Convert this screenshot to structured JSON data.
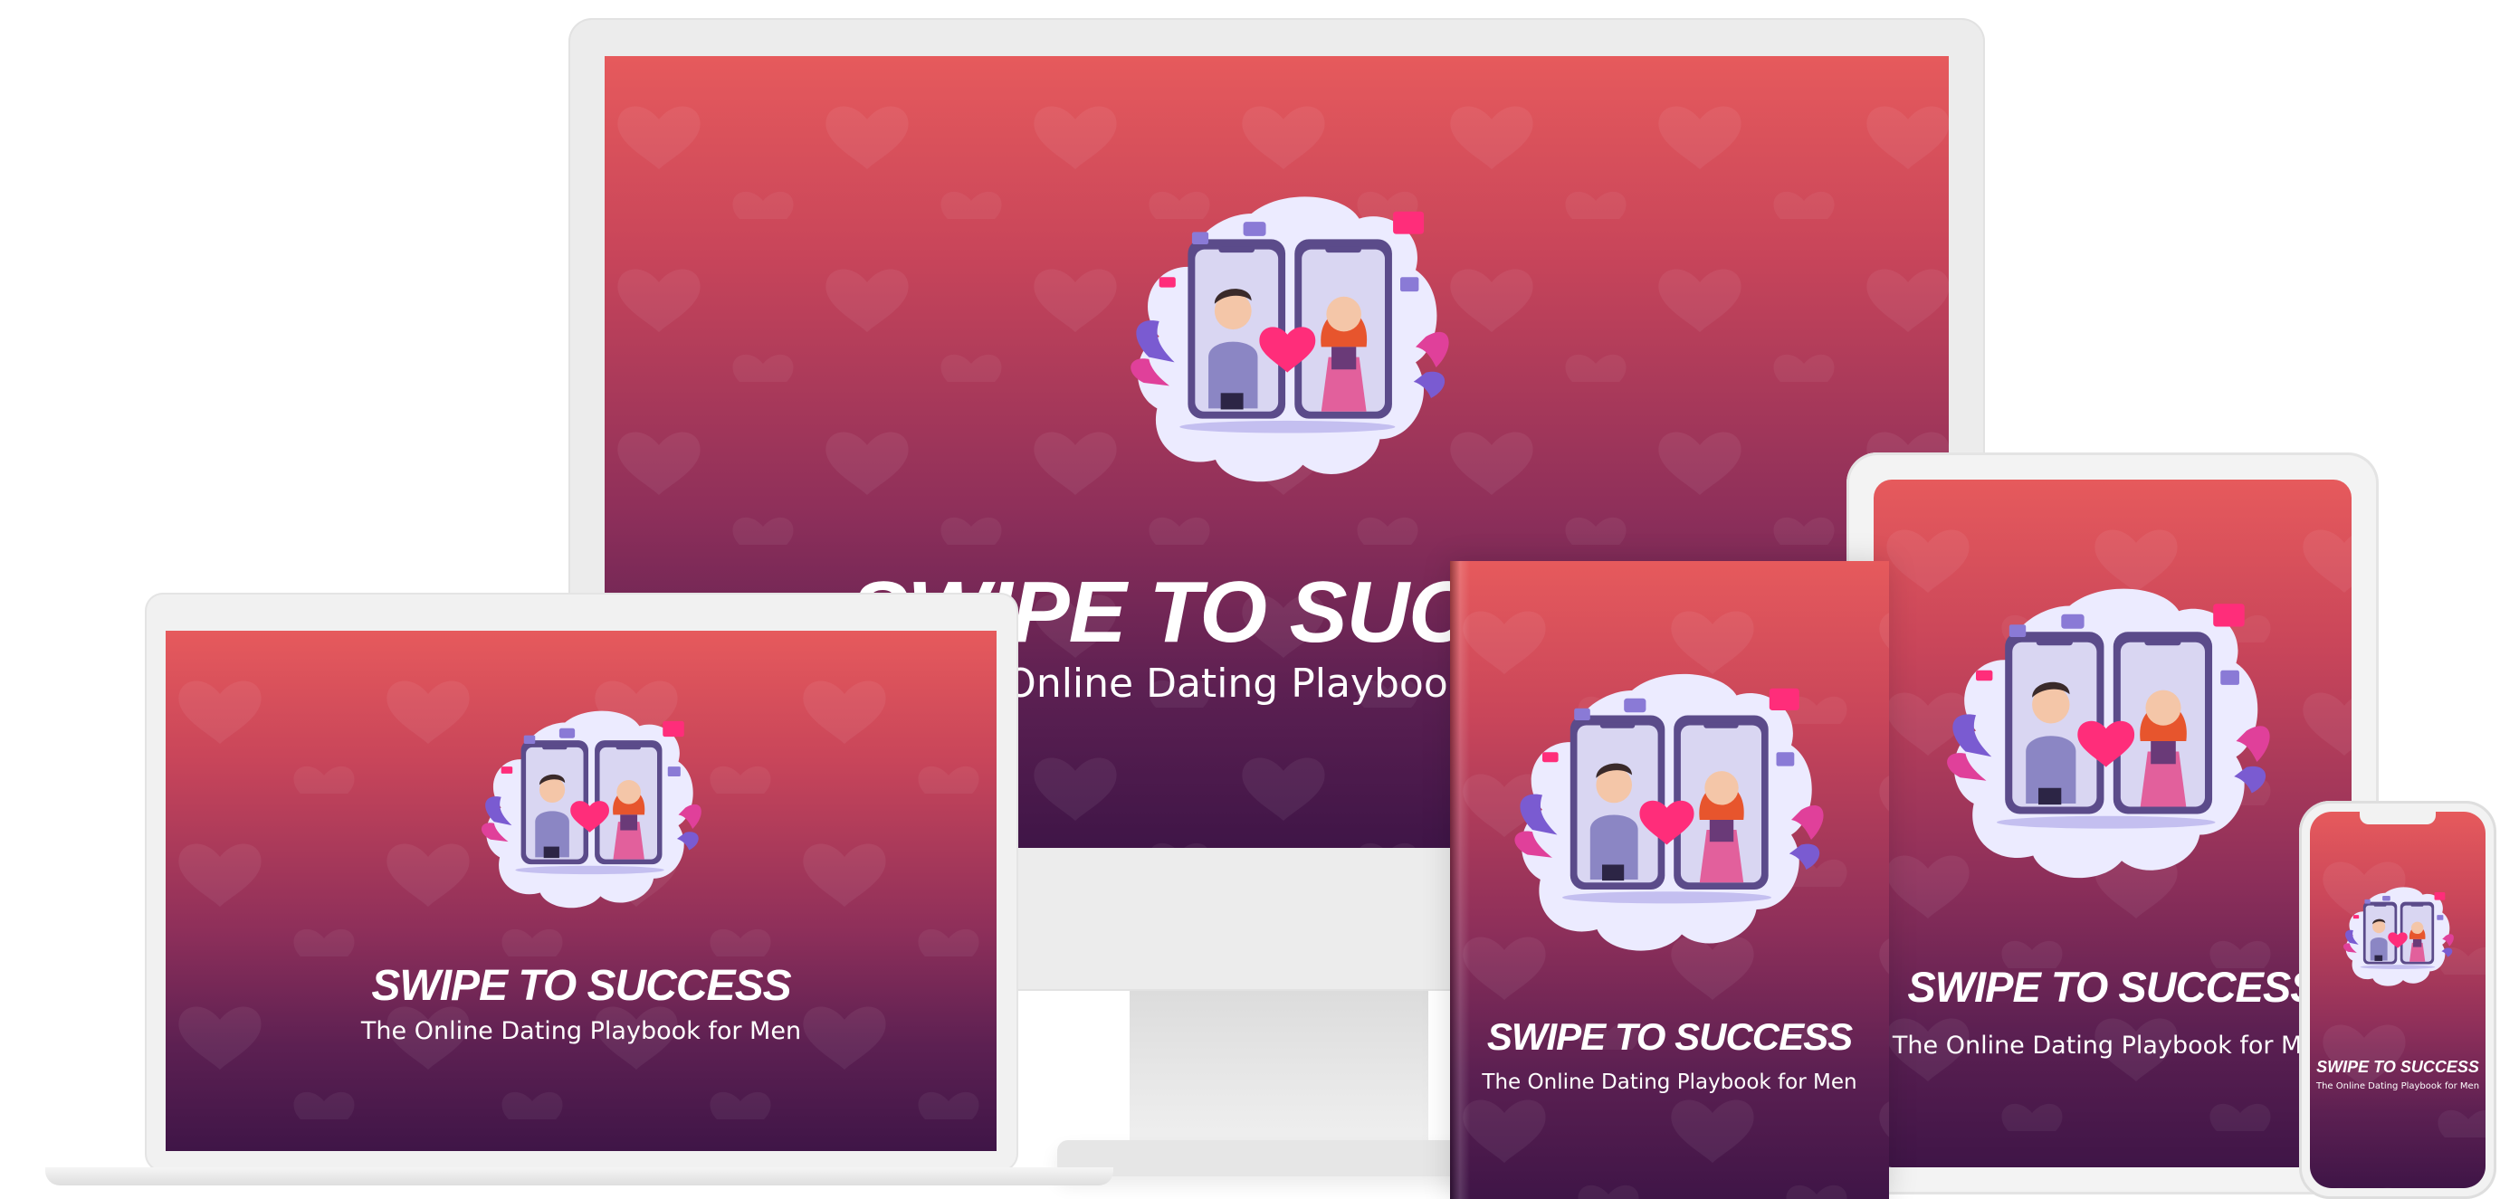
{
  "product": {
    "title": "SWIPE TO SUCCESS",
    "subtitle": "The Online Dating Playbook for Men"
  },
  "devices": {
    "monitor": {
      "title": "SWIPE TO SUCCESS",
      "subtitle": "The Online Dating Playbook for Men"
    },
    "laptop": {
      "title": "SWIPE TO SUCCESS",
      "subtitle": "The Online Dating Playbook for Men"
    },
    "book": {
      "title": "SWIPE TO SUCCESS",
      "subtitle": "The Online Dating Playbook for Men"
    },
    "tablet": {
      "title": "SWIPE TO SUCCESS",
      "subtitle": "The Online Dating Playbook for Men"
    },
    "phone": {
      "title": "SWIPE TO SUCCESS",
      "subtitle": "The Online Dating Playbook for Men"
    }
  },
  "colors": {
    "gradient_top": "#e65a5c",
    "gradient_bottom": "#3f1547",
    "heart_accent": "#ff2d7a",
    "phone_frame": "#5b4b8a",
    "bubble": "#ecebff"
  }
}
